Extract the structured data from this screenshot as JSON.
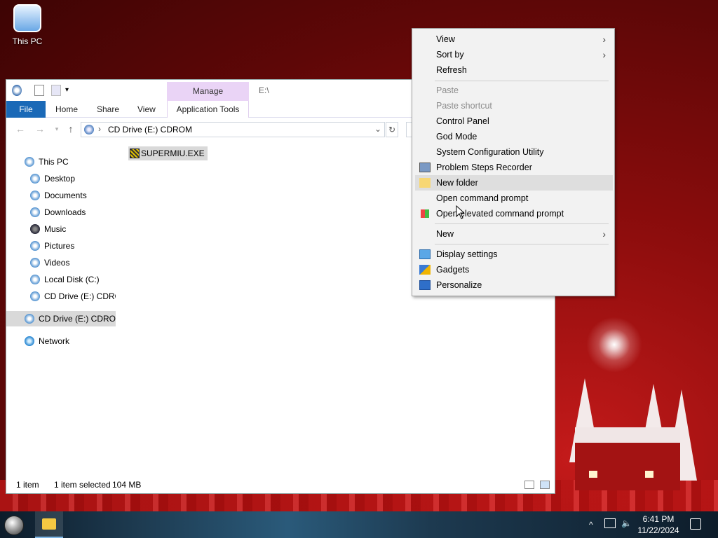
{
  "desktop": {
    "icons": [
      {
        "label": "This PC",
        "icon": "this-pc-icon"
      }
    ]
  },
  "explorer": {
    "contextual_tab": "Manage",
    "title_path": "E:\\",
    "ribbon_tabs": [
      "File",
      "Home",
      "Share",
      "View",
      "Application Tools"
    ],
    "address": {
      "drive_icon": "cd-drive-icon",
      "path": "CD Drive (E:) CDROM"
    },
    "nav_items": [
      {
        "label": "This PC",
        "icon": "this-pc-icon"
      },
      {
        "label": "Desktop",
        "icon": "desktop-icon"
      },
      {
        "label": "Documents",
        "icon": "documents-icon"
      },
      {
        "label": "Downloads",
        "icon": "downloads-icon"
      },
      {
        "label": "Music",
        "icon": "music-icon"
      },
      {
        "label": "Pictures",
        "icon": "pictures-icon"
      },
      {
        "label": "Videos",
        "icon": "videos-icon"
      },
      {
        "label": "Local Disk (C:)",
        "icon": "local-disk-icon"
      },
      {
        "label": "CD Drive (E:) CDROM",
        "icon": "cd-drive-icon"
      },
      {
        "label": "CD Drive (E:) CDROM",
        "icon": "cd-drive-icon"
      },
      {
        "label": "Network",
        "icon": "network-icon"
      }
    ],
    "files": [
      {
        "name": "SUPERMIU.EXE",
        "icon": "exe-icon"
      }
    ],
    "status": {
      "items": "1 item",
      "selected": "1 item selected",
      "size": "104 MB"
    }
  },
  "context_menu": {
    "items": [
      {
        "label": "View",
        "submenu": true
      },
      {
        "label": "Sort by",
        "submenu": true
      },
      {
        "label": "Refresh"
      },
      {
        "label": "Paste",
        "disabled": true
      },
      {
        "label": "Paste shortcut",
        "disabled": true
      },
      {
        "label": "Control Panel"
      },
      {
        "label": "God Mode"
      },
      {
        "label": "System Configuration Utility"
      },
      {
        "label": "Problem Steps Recorder",
        "icon": "steps-recorder-icon"
      },
      {
        "label": "New folder",
        "icon": "folder-icon",
        "highlighted": true
      },
      {
        "label": "Open command prompt"
      },
      {
        "label": "Open elevated command prompt",
        "icon": "windows-flag-icon"
      },
      {
        "label": "New",
        "submenu": true
      },
      {
        "label": "Display settings",
        "icon": "display-icon"
      },
      {
        "label": "Gadgets",
        "icon": "gadgets-icon"
      },
      {
        "label": "Personalize",
        "icon": "personalize-icon"
      }
    ]
  },
  "taskbar": {
    "clock_time": "6:41 PM",
    "clock_date": "11/22/2024"
  },
  "colors": {
    "accent": "#1a69b7",
    "contextual_tab_bg": "#ead4f6",
    "menu_bg": "#f2f2f2"
  }
}
